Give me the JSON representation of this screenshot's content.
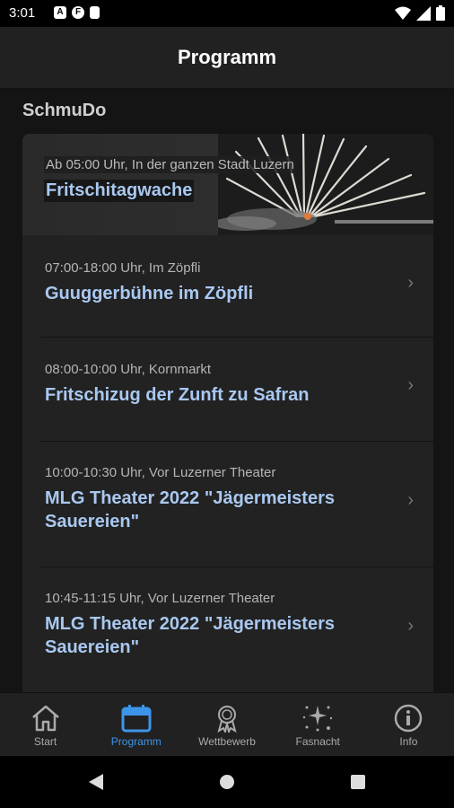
{
  "status_bar": {
    "time": "3:01",
    "icons": [
      "a-icon",
      "f-icon",
      "sd-card-icon"
    ],
    "right_icons": [
      "wifi-icon",
      "signal-icon",
      "battery-icon"
    ]
  },
  "app_bar": {
    "title": "Programm"
  },
  "section": {
    "title": "SchmuDo"
  },
  "featured": {
    "subtitle": "Ab 05:00 Uhr, In der ganzen Stadt Luzern",
    "title": "Fritschitagwache"
  },
  "events": [
    {
      "subtitle": "07:00-18:00 Uhr, Im Zöpfli",
      "title": "Guuggerbühne im Zöpfli"
    },
    {
      "subtitle": "08:00-10:00 Uhr, Kornmarkt",
      "title": "Fritschizug der Zunft zu Safran"
    },
    {
      "subtitle": "10:00-10:30 Uhr, Vor Luzerner Theater",
      "title": "MLG Theater 2022 \"Jägermeisters Sauereien\""
    },
    {
      "subtitle": "10:45-11:15 Uhr, Vor Luzerner Theater",
      "title": "MLG Theater 2022 \"Jägermeisters Sauereien\""
    }
  ],
  "bottom_nav": [
    {
      "label": "Start",
      "icon": "home-icon",
      "active": false
    },
    {
      "label": "Programm",
      "icon": "calendar-icon",
      "active": true
    },
    {
      "label": "Wettbewerb",
      "icon": "award-icon",
      "active": false
    },
    {
      "label": "Fasnacht",
      "icon": "sparkles-icon",
      "active": false
    },
    {
      "label": "Info",
      "icon": "info-icon",
      "active": false
    }
  ],
  "colors": {
    "accent": "#3d95e8",
    "title_blue": "#a9c8f0",
    "card_bg": "#222222",
    "bar_bg": "#212121"
  }
}
